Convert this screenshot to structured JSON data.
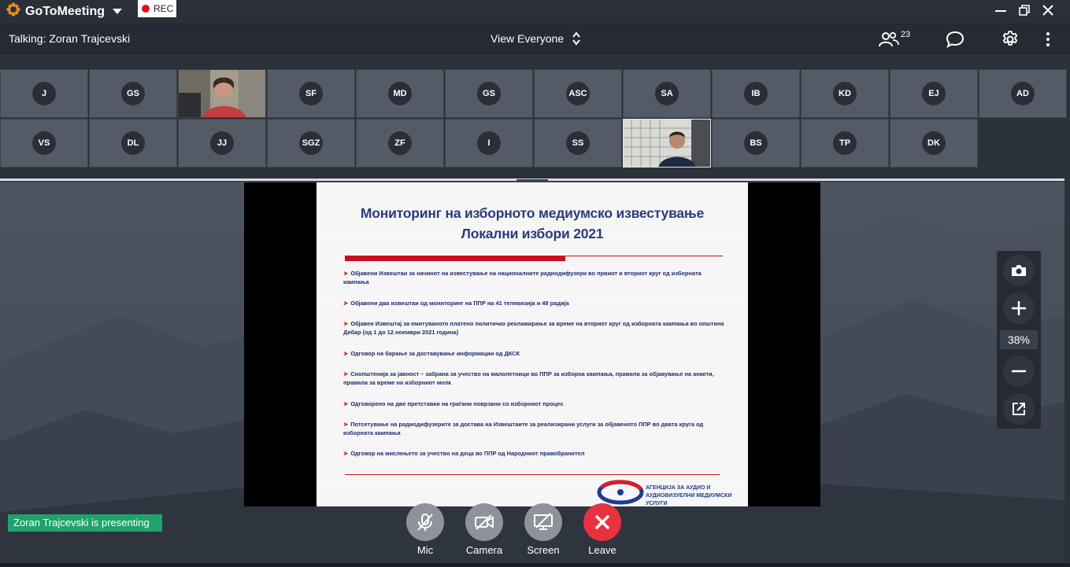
{
  "app": {
    "name": "GoToMeeting",
    "rec_label": "REC"
  },
  "header": {
    "talking": "Talking: Zoran Trajcevski",
    "view": "View Everyone",
    "participants_count": "23"
  },
  "participants": {
    "row1": [
      "J",
      "GS",
      "",
      "SF",
      "MD",
      "GS",
      "ASC",
      "SA",
      "IB",
      "KD",
      "EJ",
      "AD"
    ],
    "row2": [
      "VS",
      "DL",
      "JJ",
      "SGZ",
      "ZF",
      "I",
      "SS",
      "",
      "BS",
      "TP",
      "DK"
    ]
  },
  "slide": {
    "title_line1": "Мониторинг на изборното медиумско известување",
    "title_line2": "Локални избори 2021",
    "bullets": [
      "Објавени Извештаи за начинот на известување на националните радиодифузери во првиот и вториот круг од изборната кампања",
      "Објавени два извештаи од мониторинг на ППР на 41 телевизија и 48 радија",
      "Објавен Извештај за емитуваното платено политичко рекламирање за време на вториот круг од изборната кампања во општина Дебар (од 1 до 12 ноември 2021 година)",
      "Одговор на барање за доставување информации од ДКСК",
      "Соопштенија за јавност – забрана за учество на малолетници во ППР за изборна кампања, правила за објавување на анкети, правила за време на изборниот молк",
      "Одговорено на две претставки на граѓани поврзани со изборниот процес",
      "Потсетување на радиодифузерите за достава на Извештаите за реализирани услуги за објавеното ППР во двата круга од изборната кампања",
      "Одговор на мислењето за учество на деца во ППР од Народниот правобранител"
    ],
    "logo_line1": "АГЕНЦИЈА ЗА АУДИО И",
    "logo_line2": "АУДИОВИЗУЕЛНИ МЕДИУМСКИ УСЛУГИ"
  },
  "zoom": {
    "percent": "38%"
  },
  "presenter_banner": "Zoran Trajcevski is presenting",
  "controls": {
    "mic": "Mic",
    "camera": "Camera",
    "screen": "Screen",
    "leave": "Leave"
  },
  "colors": {
    "leave": "#e8323f",
    "presenting": "#1fa36b",
    "brand_orange": "#f68b1f",
    "rec": "#e0101b"
  }
}
